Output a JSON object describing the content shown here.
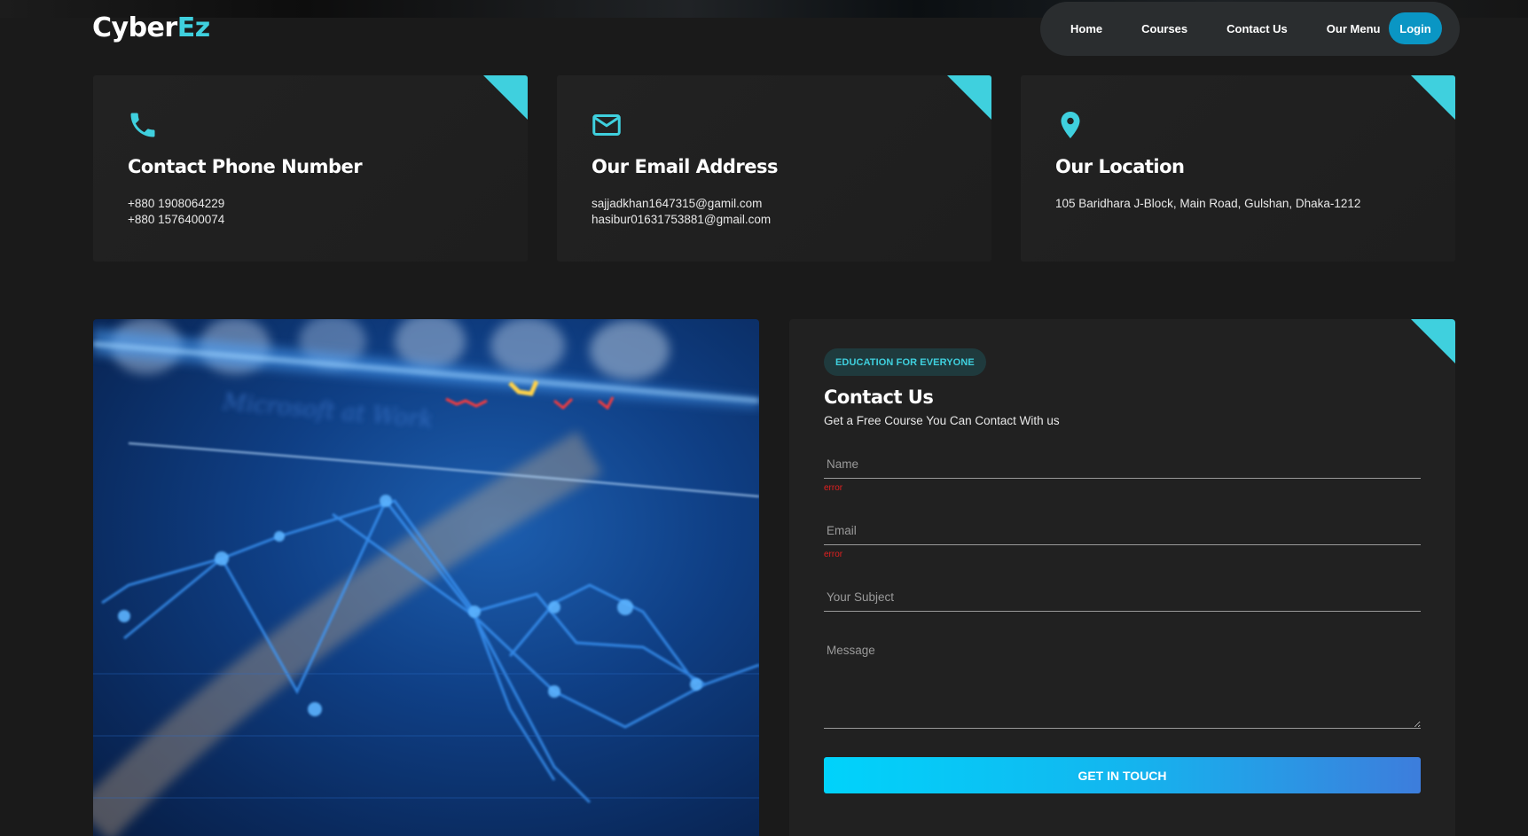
{
  "header": {
    "logo_main": "Cyber",
    "logo_accent": "Ez",
    "nav": [
      "Home",
      "Courses",
      "Contact Us",
      "Our Menu"
    ],
    "login_label": "Login"
  },
  "cards": [
    {
      "title": "Contact Phone Number",
      "lines": [
        "+880 1908064229",
        "+880 1576400074"
      ],
      "icon": "phone-icon"
    },
    {
      "title": "Our Email Address",
      "lines": [
        "sajjadkhan1647315@gamil.com",
        "hasibur01631753881@gmail.com"
      ],
      "icon": "envelope-icon"
    },
    {
      "title": "Our Location",
      "lines": [
        "105 Baridhara J-Block, Main Road, Gulshan, Dhaka-1212"
      ],
      "icon": "map-pin-icon"
    }
  ],
  "form": {
    "badge": "EDUCATION FOR EVERYONE",
    "title": "Contact Us",
    "subtitle": "Get a Free Course You Can Contact With us",
    "name_placeholder": "Name",
    "email_placeholder": "Email",
    "subject_placeholder": "Your Subject",
    "message_placeholder": "Message",
    "name_error": "error",
    "email_error": "error",
    "submit_label": "GET IN TOUCH"
  },
  "colors": {
    "accent": "#3fd0de",
    "login": "#0a96c4",
    "background": "#1a1a1a",
    "error": "#e02020"
  }
}
